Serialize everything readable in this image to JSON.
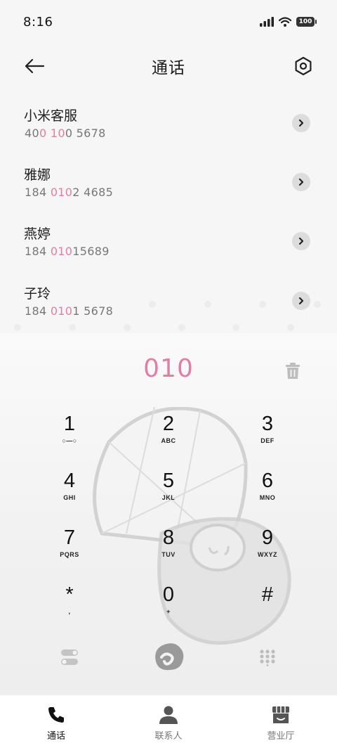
{
  "status": {
    "time": "8:16",
    "battery": "100",
    "icons": [
      "signal-icon",
      "wifi-icon",
      "battery-icon"
    ]
  },
  "header": {
    "title": "通话",
    "back_icon": "arrow-left-icon",
    "settings_icon": "hexagon-settings-icon"
  },
  "contacts": [
    {
      "name": "小米客服",
      "number_parts": [
        "40",
        "0",
        " ",
        "10",
        "0 5678"
      ]
    },
    {
      "name": "雅娜",
      "number_parts": [
        "184 ",
        "010",
        "2 4685"
      ]
    },
    {
      "name": "燕婷",
      "number_parts": [
        "184 ",
        "010",
        "15689"
      ]
    },
    {
      "name": "子玲",
      "number_parts": [
        "184 ",
        "010",
        "1 5678"
      ]
    }
  ],
  "dialer": {
    "input": "010",
    "delete_icon": "trash-icon",
    "keys": [
      {
        "digit": "1",
        "letters": "○—○"
      },
      {
        "digit": "2",
        "letters": "ABC"
      },
      {
        "digit": "3",
        "letters": "DEF"
      },
      {
        "digit": "4",
        "letters": "GHI"
      },
      {
        "digit": "5",
        "letters": "JKL"
      },
      {
        "digit": "6",
        "letters": "MNO"
      },
      {
        "digit": "7",
        "letters": "PQRS"
      },
      {
        "digit": "8",
        "letters": "TUV"
      },
      {
        "digit": "9",
        "letters": "WXYZ"
      },
      {
        "digit": "*",
        "letters": ","
      },
      {
        "digit": "0",
        "letters": "+"
      },
      {
        "digit": "#",
        "letters": ""
      }
    ],
    "tools": [
      "toggle-icon",
      "call-button-icon",
      "keypad-icon"
    ]
  },
  "nav": {
    "items": [
      {
        "label": "通话",
        "icon": "phone-icon",
        "active": true
      },
      {
        "label": "联系人",
        "icon": "person-icon",
        "active": false
      },
      {
        "label": "营业厅",
        "icon": "store-icon",
        "active": false
      }
    ]
  },
  "colors": {
    "accent": "#e07fa6",
    "text": "#111111",
    "muted": "#777777"
  }
}
